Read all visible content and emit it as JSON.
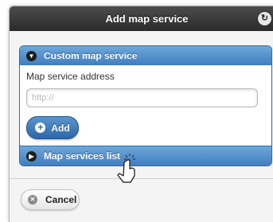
{
  "dialog": {
    "title": "Add map service",
    "header_button_icon": "refresh-icon"
  },
  "custom_section": {
    "heading": "Custom map service",
    "expanded": true,
    "field_label": "Map service address",
    "input_value": "",
    "input_placeholder": "http://",
    "add_button_label": "Add"
  },
  "list_section": {
    "heading": "Map services list",
    "expanded": false
  },
  "footer": {
    "cancel_label": "Cancel"
  },
  "colors": {
    "header_bg": "#333333",
    "accent_blue": "#3f7ec1",
    "dialog_bg": "#f4f4f4"
  }
}
